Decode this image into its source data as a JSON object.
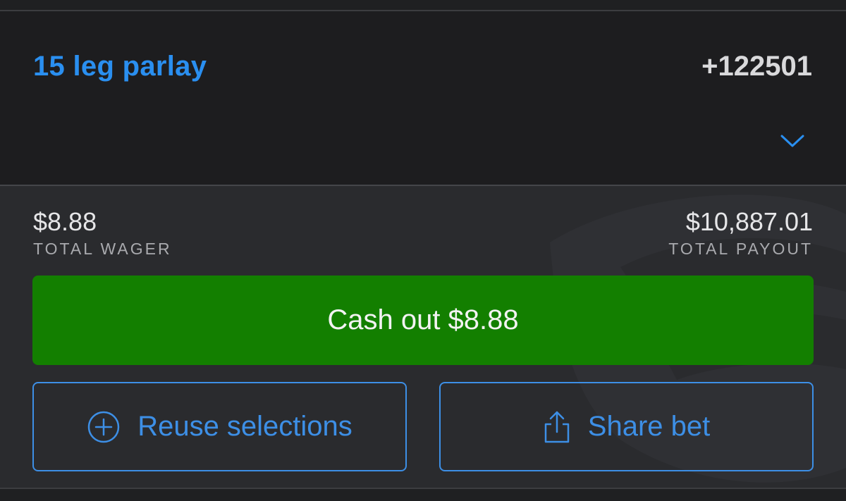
{
  "bet": {
    "title": "15 leg parlay",
    "odds": "+122501",
    "expand_icon": "chevron-down-icon"
  },
  "summary": {
    "wager_amount": "$8.88",
    "wager_caption": "TOTAL WAGER",
    "payout_amount": "$10,887.01",
    "payout_caption": "TOTAL PAYOUT"
  },
  "actions": {
    "cashout_label": "Cash out $8.88",
    "reuse_label": "Reuse selections",
    "reuse_icon": "plus-circle-icon",
    "share_label": "Share bet",
    "share_icon": "share-icon"
  },
  "colors": {
    "accent": "#2a8ff0",
    "cashout_green": "#137f00",
    "background": "#1d1d1f",
    "summary_background": "#2a2b2e"
  }
}
